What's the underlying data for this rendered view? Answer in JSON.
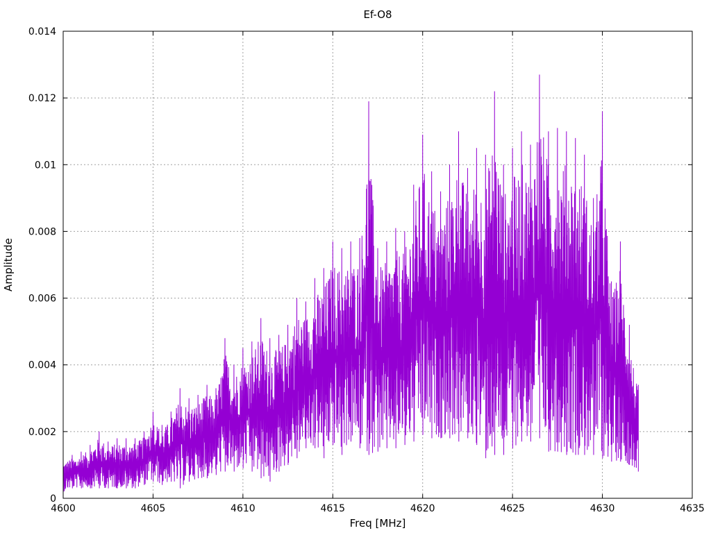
{
  "chart_data": {
    "type": "line",
    "title": "Ef-O8",
    "xlabel": "Freq [MHz]",
    "ylabel": "Amplitude",
    "xlim": [
      4600,
      4635
    ],
    "ylim": [
      0,
      0.014
    ],
    "xticks": [
      4600,
      4605,
      4610,
      4615,
      4620,
      4625,
      4630,
      4635
    ],
    "xtick_labels": [
      "4600",
      "4605",
      "4610",
      "4615",
      "4620",
      "4625",
      "4630",
      "4635"
    ],
    "yticks": [
      0,
      0.002,
      0.004,
      0.006,
      0.008,
      0.01,
      0.012,
      0.014
    ],
    "ytick_labels": [
      "0",
      "0.002",
      "0.004",
      "0.006",
      "0.008",
      "0.01",
      "0.012",
      "0.014"
    ],
    "grid": true,
    "legend": "none",
    "series_color": "#9400d3",
    "series": [
      {
        "x": [
          4600,
          4600.5,
          4601,
          4601.5,
          4602,
          4602.5,
          4603,
          4603.5,
          4604,
          4604.5,
          4605,
          4605.5,
          4606,
          4606.5,
          4607,
          4607.5,
          4608,
          4608.5,
          4609,
          4609.5,
          4610,
          4610.5,
          4611,
          4611.5,
          4612,
          4612.5,
          4613,
          4613.5,
          4614,
          4614.5,
          4615,
          4615.5,
          4616,
          4616.5,
          4617,
          4617.5,
          4618,
          4618.5,
          4619,
          4619.5,
          4620,
          4620.5,
          4621,
          4621.5,
          4622,
          4622.5,
          4623,
          4623.5,
          4624,
          4624.5,
          4625,
          4625.5,
          4626,
          4626.5,
          4627,
          4627.5,
          4628,
          4628.5,
          4629,
          4629.5,
          4630,
          4630.5,
          4631,
          4631.5,
          4632
        ],
        "y_low": [
          0.0002,
          0.0003,
          0.0003,
          0.0003,
          0.0003,
          0.0003,
          0.0003,
          0.0003,
          0.0003,
          0.0004,
          0.0005,
          0.0004,
          0.0005,
          0.0003,
          0.0005,
          0.0006,
          0.0006,
          0.0007,
          0.0008,
          0.0008,
          0.0009,
          0.0008,
          0.0006,
          0.0005,
          0.0008,
          0.001,
          0.0012,
          0.0015,
          0.0015,
          0.0012,
          0.0016,
          0.0013,
          0.0017,
          0.0015,
          0.0013,
          0.0014,
          0.0015,
          0.0015,
          0.0016,
          0.0017,
          0.0019,
          0.0018,
          0.0018,
          0.0018,
          0.0017,
          0.0018,
          0.0016,
          0.0012,
          0.0013,
          0.0013,
          0.0015,
          0.0017,
          0.0017,
          0.0018,
          0.0014,
          0.0014,
          0.0013,
          0.0013,
          0.0013,
          0.0013,
          0.0012,
          0.0011,
          0.0011,
          0.001,
          0.0008
        ],
        "y_high": [
          0.0012,
          0.0013,
          0.0014,
          0.0016,
          0.002,
          0.0017,
          0.0018,
          0.0018,
          0.0018,
          0.002,
          0.0026,
          0.0022,
          0.0026,
          0.0033,
          0.003,
          0.0031,
          0.0034,
          0.0033,
          0.0048,
          0.004,
          0.0045,
          0.0047,
          0.0054,
          0.0048,
          0.0049,
          0.0052,
          0.006,
          0.0059,
          0.0066,
          0.0069,
          0.0077,
          0.0075,
          0.0077,
          0.0078,
          0.0119,
          0.0075,
          0.0077,
          0.0081,
          0.008,
          0.0094,
          0.0109,
          0.0098,
          0.0092,
          0.01,
          0.011,
          0.0099,
          0.0105,
          0.0103,
          0.0122,
          0.01,
          0.0105,
          0.011,
          0.0106,
          0.0127,
          0.011,
          0.0111,
          0.011,
          0.0108,
          0.0103,
          0.009,
          0.0116,
          0.0065,
          0.0077,
          0.0052,
          0.0034
        ]
      }
    ]
  }
}
